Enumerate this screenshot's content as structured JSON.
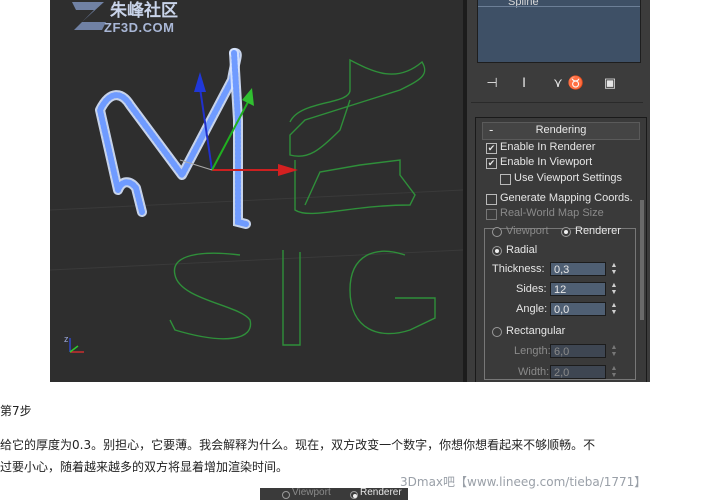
{
  "watermark": {
    "logo_text": "朱峰社区",
    "logo_url": "ZF3D.COM"
  },
  "viewport": {
    "axis_label": "z"
  },
  "command_panel": {
    "list_item": "Spline",
    "toolbar": [
      "pin-stack-icon",
      "show-end-result-icon",
      "make-unique-icon",
      "remove-modifier-icon",
      "configure-sets-icon"
    ]
  },
  "rendering_rollout": {
    "title": "Rendering",
    "collapse_symbol": "-",
    "enable_in_renderer": "Enable In Renderer",
    "enable_in_viewport": "Enable In Viewport",
    "use_viewport_settings": "Use Viewport Settings",
    "generate_mapping_coords": "Generate Mapping Coords.",
    "real_world_map_size": "Real-World Map Size",
    "viewport_option": "Viewport",
    "renderer_option": "Renderer",
    "radial": "Radial",
    "thickness_label": "Thickness:",
    "thickness_value": "0,3",
    "sides_label": "Sides:",
    "sides_value": "12",
    "angle_label": "Angle:",
    "angle_value": "0,0",
    "rectangular": "Rectangular",
    "length_label": "Length:",
    "length_value": "6,0",
    "width_label": "Width:",
    "width_value": "2,0"
  },
  "article": {
    "step_heading": "第7步",
    "paragraph_line1": "给它的厚度为0.3。别担心，它要薄。我会解释为什么。现在，双方改变一个数字，你想你想看起来不够顺畅。不",
    "paragraph_line2": "过要小心，随着越来越多的双方将显着增加渲染时间。"
  },
  "bottom_crop": {
    "viewport_option": "Viewport",
    "renderer_option": "Renderer"
  },
  "site_watermark": "3Dmax吧【www.lineeg.com/tieba/1771】",
  "colors": {
    "viewport_bg": "#2e2e2e",
    "panel_bg": "#3c3c3c",
    "spinner_bg": "#4f5f73",
    "spline_green": "#2f8f3a",
    "mesh_blue": "#a8c8ff"
  }
}
